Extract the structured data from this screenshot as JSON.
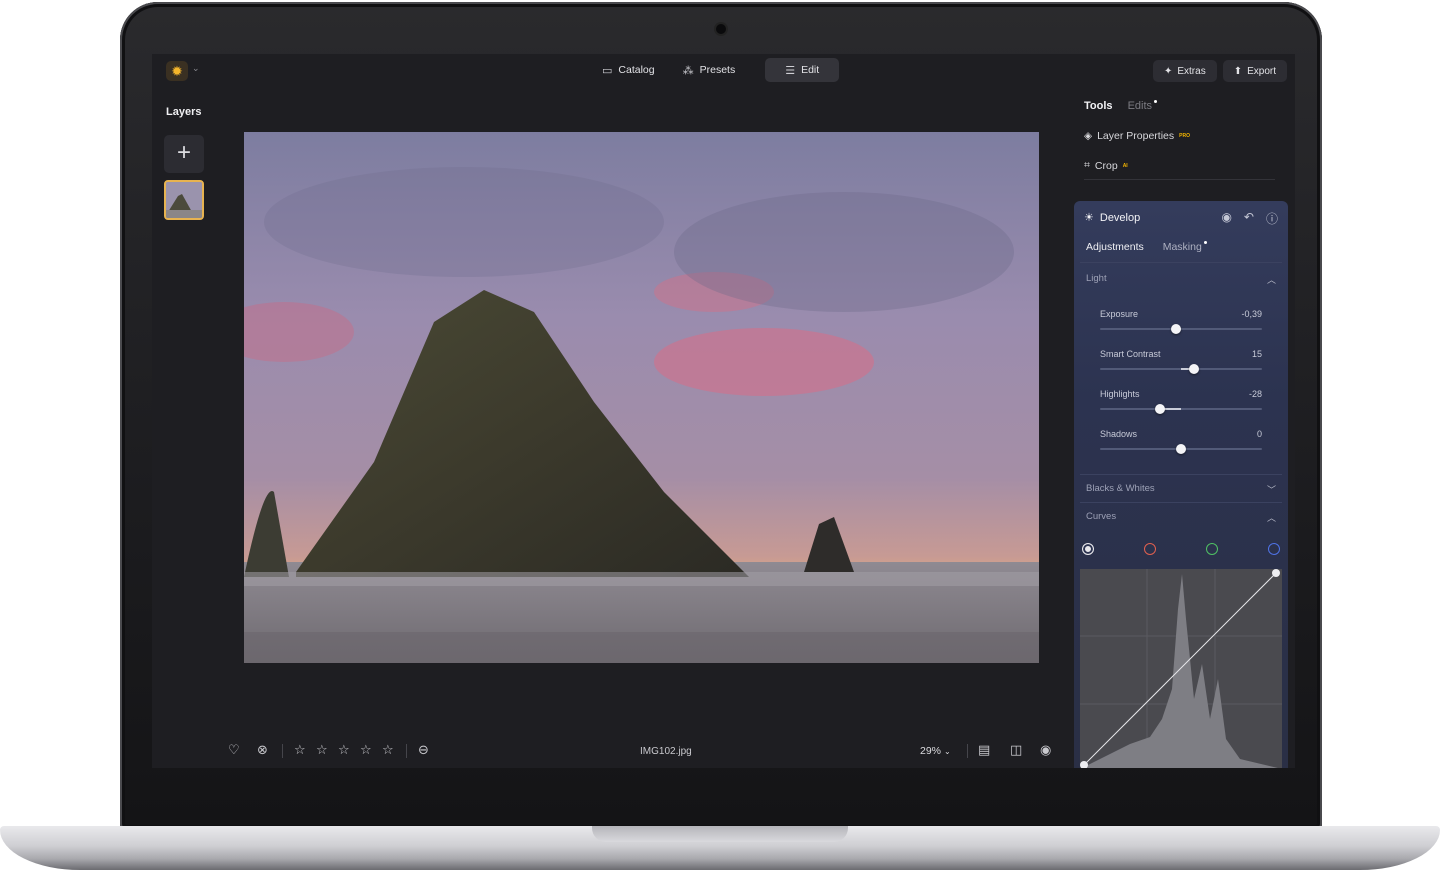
{
  "topbar": {
    "tabs": [
      {
        "label": "Catalog",
        "icon": "folder-icon"
      },
      {
        "label": "Presets",
        "icon": "sparkle-icon"
      },
      {
        "label": "Edit",
        "icon": "sliders-icon"
      }
    ],
    "active_tab": "Edit",
    "extras_label": "Extras",
    "export_label": "Export"
  },
  "layers": {
    "title": "Layers",
    "add_label": "+"
  },
  "toolbar": {
    "filename": "IMG102.jpg",
    "zoom": "29%"
  },
  "panel": {
    "tab_tools": "Tools",
    "tab_edits": "Edits",
    "layer_properties": "Layer Properties",
    "layer_properties_badge": "PRO",
    "crop": "Crop",
    "crop_badge": "AI",
    "develop_title": "Develop",
    "subtab_adjustments": "Adjustments",
    "subtab_masking": "Masking",
    "section_light": "Light",
    "section_blacks_whites": "Blacks & Whites",
    "section_curves": "Curves",
    "sliders": [
      {
        "label": "Exposure",
        "value": "-0,39",
        "position": 0.47
      },
      {
        "label": "Smart Contrast",
        "value": "15",
        "position": 0.58
      },
      {
        "label": "Highlights",
        "value": "-28",
        "position": 0.37
      },
      {
        "label": "Shadows",
        "value": "0",
        "position": 0.5
      }
    ],
    "curve_channels": [
      {
        "name": "rgb",
        "color": "#e8e8ec"
      },
      {
        "name": "red",
        "color": "#e0604f"
      },
      {
        "name": "green",
        "color": "#4fc064"
      },
      {
        "name": "blue",
        "color": "#4f73e6"
      }
    ]
  },
  "colors": {
    "accent": "#f4b52b",
    "panel": "#2c3350",
    "background": "#1e1e22"
  }
}
